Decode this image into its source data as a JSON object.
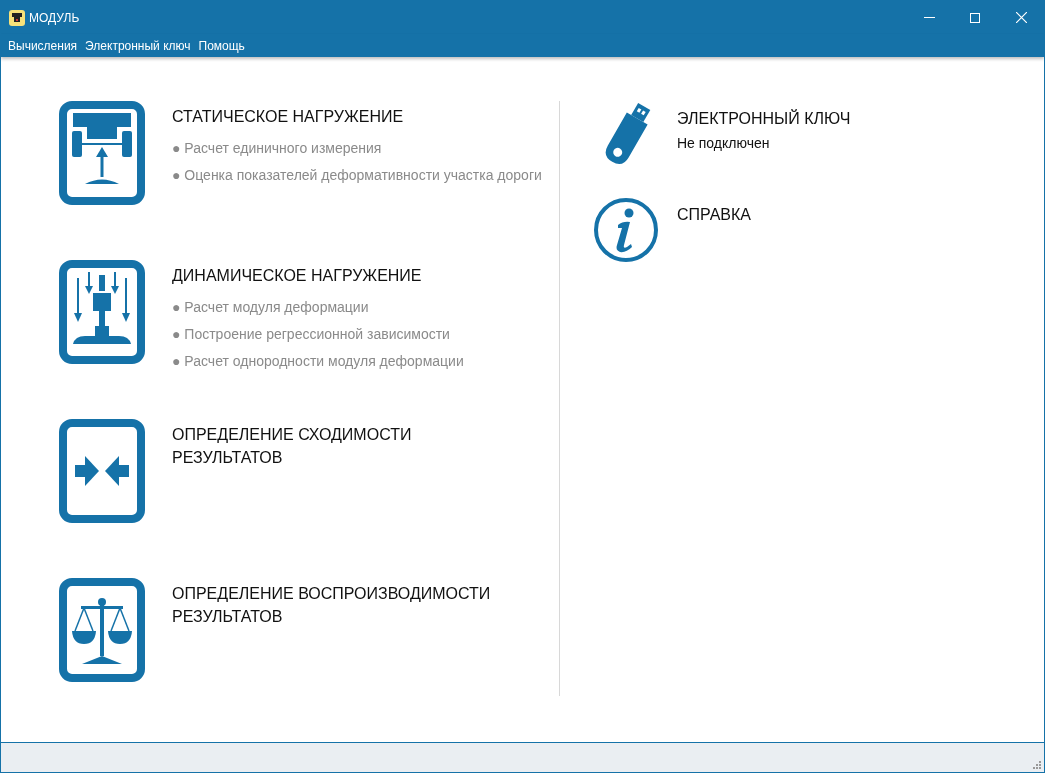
{
  "window": {
    "title": "МОДУЛЬ"
  },
  "menu": [
    "Вычисления",
    "Электронный ключ",
    "Помощь"
  ],
  "sections": [
    {
      "kind": "static",
      "title": "СТАТИЧЕСКОЕ НАГРУЖЕНИЕ",
      "items": [
        "● Расчет единичного измерения",
        "● Оценка показателей деформативности участка дороги"
      ]
    },
    {
      "kind": "dynamic",
      "title": "ДИНАМИЧЕСКОЕ НАГРУЖЕНИЕ",
      "items": [
        "● Расчет модуля деформации",
        "● Построение регрессионной зависимости",
        "● Расчет однородности модуля деформации"
      ]
    },
    {
      "kind": "convergence",
      "title": "ОПРЕДЕЛЕНИЕ СХОДИМОСТИ РЕЗУЛЬТАТОВ"
    },
    {
      "kind": "reproducibility",
      "title": "ОПРЕДЕЛЕНИЕ ВОСПРОИЗВОДИМОСТИ РЕЗУЛЬТАТОВ"
    }
  ],
  "side": [
    {
      "kind": "key",
      "title": "ЭЛЕКТРОННЫЙ КЛЮЧ",
      "status": "Не подключен"
    },
    {
      "kind": "help",
      "title": "СПРАВКА"
    }
  ]
}
